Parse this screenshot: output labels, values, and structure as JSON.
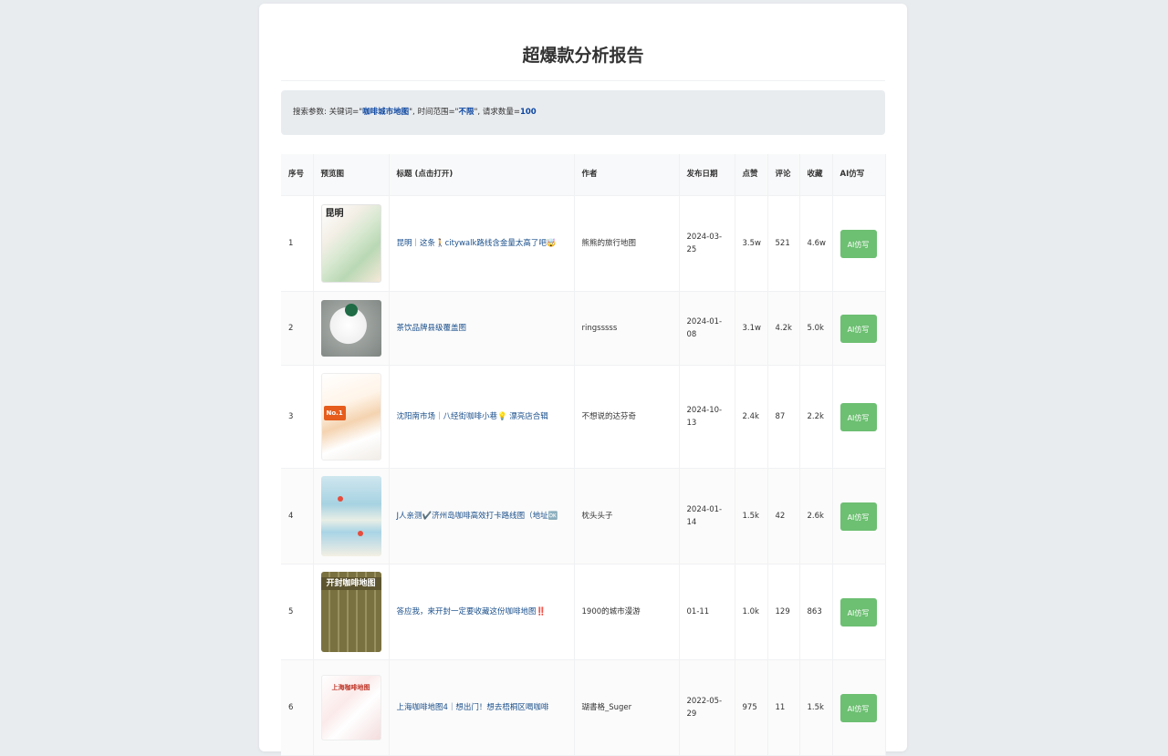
{
  "report": {
    "title": "超爆款分析报告"
  },
  "search": {
    "prefix": "搜索参数: 关键词=\"",
    "keyword": "咖啡城市地图",
    "mid": "\", 时间范围=\"",
    "time_range": "不限",
    "mid2": "\", 请求数量=",
    "count": "100"
  },
  "table": {
    "headers": {
      "index": "序号",
      "preview": "预览图",
      "title": "标题 (点击打开)",
      "author": "作者",
      "date": "发布日期",
      "likes": "点赞",
      "comments": "评论",
      "favorites": "收藏",
      "ai": "AI仿写"
    },
    "rows": [
      {
        "index": "1",
        "thumb_text": "昆明",
        "title": "昆明｜这条🚶citywalk路线含金量太高了吧🤯",
        "author": "熊熊的旅行地图",
        "date": "2024-03-25",
        "likes": "3.5w",
        "comments": "521",
        "favorites": "4.6w",
        "ai_label": "AI仿写"
      },
      {
        "index": "2",
        "thumb_text": "",
        "title": "茶饮品牌县级覆盖图",
        "author": "ringsssss",
        "date": "2024-01-08",
        "likes": "3.1w",
        "comments": "4.2k",
        "favorites": "5.0k",
        "ai_label": "AI仿写"
      },
      {
        "index": "3",
        "thumb_text": "No.1",
        "title": "沈阳南市场｜八经街咖啡小巷💡 漂亮店合辑",
        "author": "不想说的达芬奇",
        "date": "2024-10-13",
        "likes": "2.4k",
        "comments": "87",
        "favorites": "2.2k",
        "ai_label": "AI仿写"
      },
      {
        "index": "4",
        "thumb_text": "",
        "title": "J人亲测✔️济州岛咖啡高效打卡路线图（地址🆗",
        "author": "枕头头子",
        "date": "2024-01-14",
        "likes": "1.5k",
        "comments": "42",
        "favorites": "2.6k",
        "ai_label": "AI仿写"
      },
      {
        "index": "5",
        "thumb_text": "开封咖啡地图",
        "title": "答应我，来开封一定要收藏这份咖啡地图‼️",
        "author": "1900的城市漫游",
        "date": "01-11",
        "likes": "1.0k",
        "comments": "129",
        "favorites": "863",
        "ai_label": "AI仿写"
      },
      {
        "index": "6",
        "thumb_text": "上海咖啡地图",
        "title": "上海咖啡地图4｜想出门！想去梧桐区喝咖啡",
        "author": "瑚書格_Suger",
        "date": "2022-05-29",
        "likes": "975",
        "comments": "11",
        "favorites": "1.5k",
        "ai_label": "AI仿写"
      }
    ]
  },
  "colors": {
    "accent_link": "#1a4f8b",
    "param_highlight": "#0d47a1",
    "ai_button": "#6dbf72"
  }
}
